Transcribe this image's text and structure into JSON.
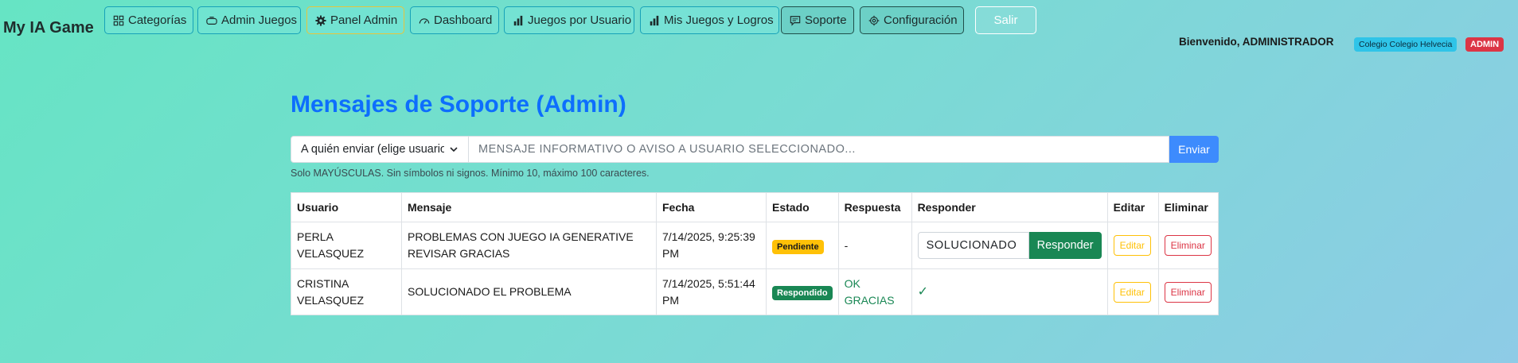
{
  "app": {
    "brand": "My IA Game"
  },
  "nav": {
    "categorias": "Categorías",
    "admin_juegos": "Admin Juegos",
    "panel_admin": "Panel Admin",
    "dashboard": "Dashboard",
    "juegos_usuario": "Juegos por Usuario",
    "mis_juegos": "Mis Juegos y Logros",
    "soporte": "Soporte",
    "configuracion": "Configuración",
    "salir": "Salir"
  },
  "user": {
    "welcome": "Bienvenido, ADMINISTRADOR",
    "school": "Colegio Colegio Helvecia",
    "role": "ADMIN"
  },
  "page": {
    "title": "Mensajes de Soporte (Admin)",
    "select_value": "A quién enviar (elige usuario)",
    "message_placeholder": "MENSAJE INFORMATIVO O AVISO A USUARIO SELECCIONADO...",
    "send_label": "Enviar",
    "hint": "Solo MAYÚSCULAS. Sin símbolos ni signos. Mínimo 10, máximo 100 caracteres."
  },
  "table": {
    "headers": [
      "Usuario",
      "Mensaje",
      "Fecha",
      "Estado",
      "Respuesta",
      "Responder",
      "Editar",
      "Eliminar"
    ],
    "rows": [
      {
        "usuario": "PERLA VELASQUEZ",
        "mensaje": "PROBLEMAS CON JUEGO IA GENERATIVE REVISAR GRACIAS",
        "fecha": "7/14/2025, 9:25:39 PM",
        "estado": "Pendiente",
        "respuesta": "-",
        "reply_value": "SOLUCIONADO",
        "reply_label": "Responder",
        "edit_label": "Editar",
        "delete_label": "Eliminar"
      },
      {
        "usuario": "CRISTINA VELASQUEZ",
        "mensaje": "SOLUCIONADO EL PROBLEMA",
        "fecha": "7/14/2025, 5:51:44 PM",
        "estado": "Respondido",
        "respuesta": "OK GRACIAS",
        "responder_mark": "✓",
        "edit_label": "Editar",
        "delete_label": "Eliminar"
      }
    ]
  },
  "colors": {
    "title": "#0d6efd",
    "pending": "#ffc107",
    "answered": "#198754",
    "danger": "#dc3545"
  }
}
